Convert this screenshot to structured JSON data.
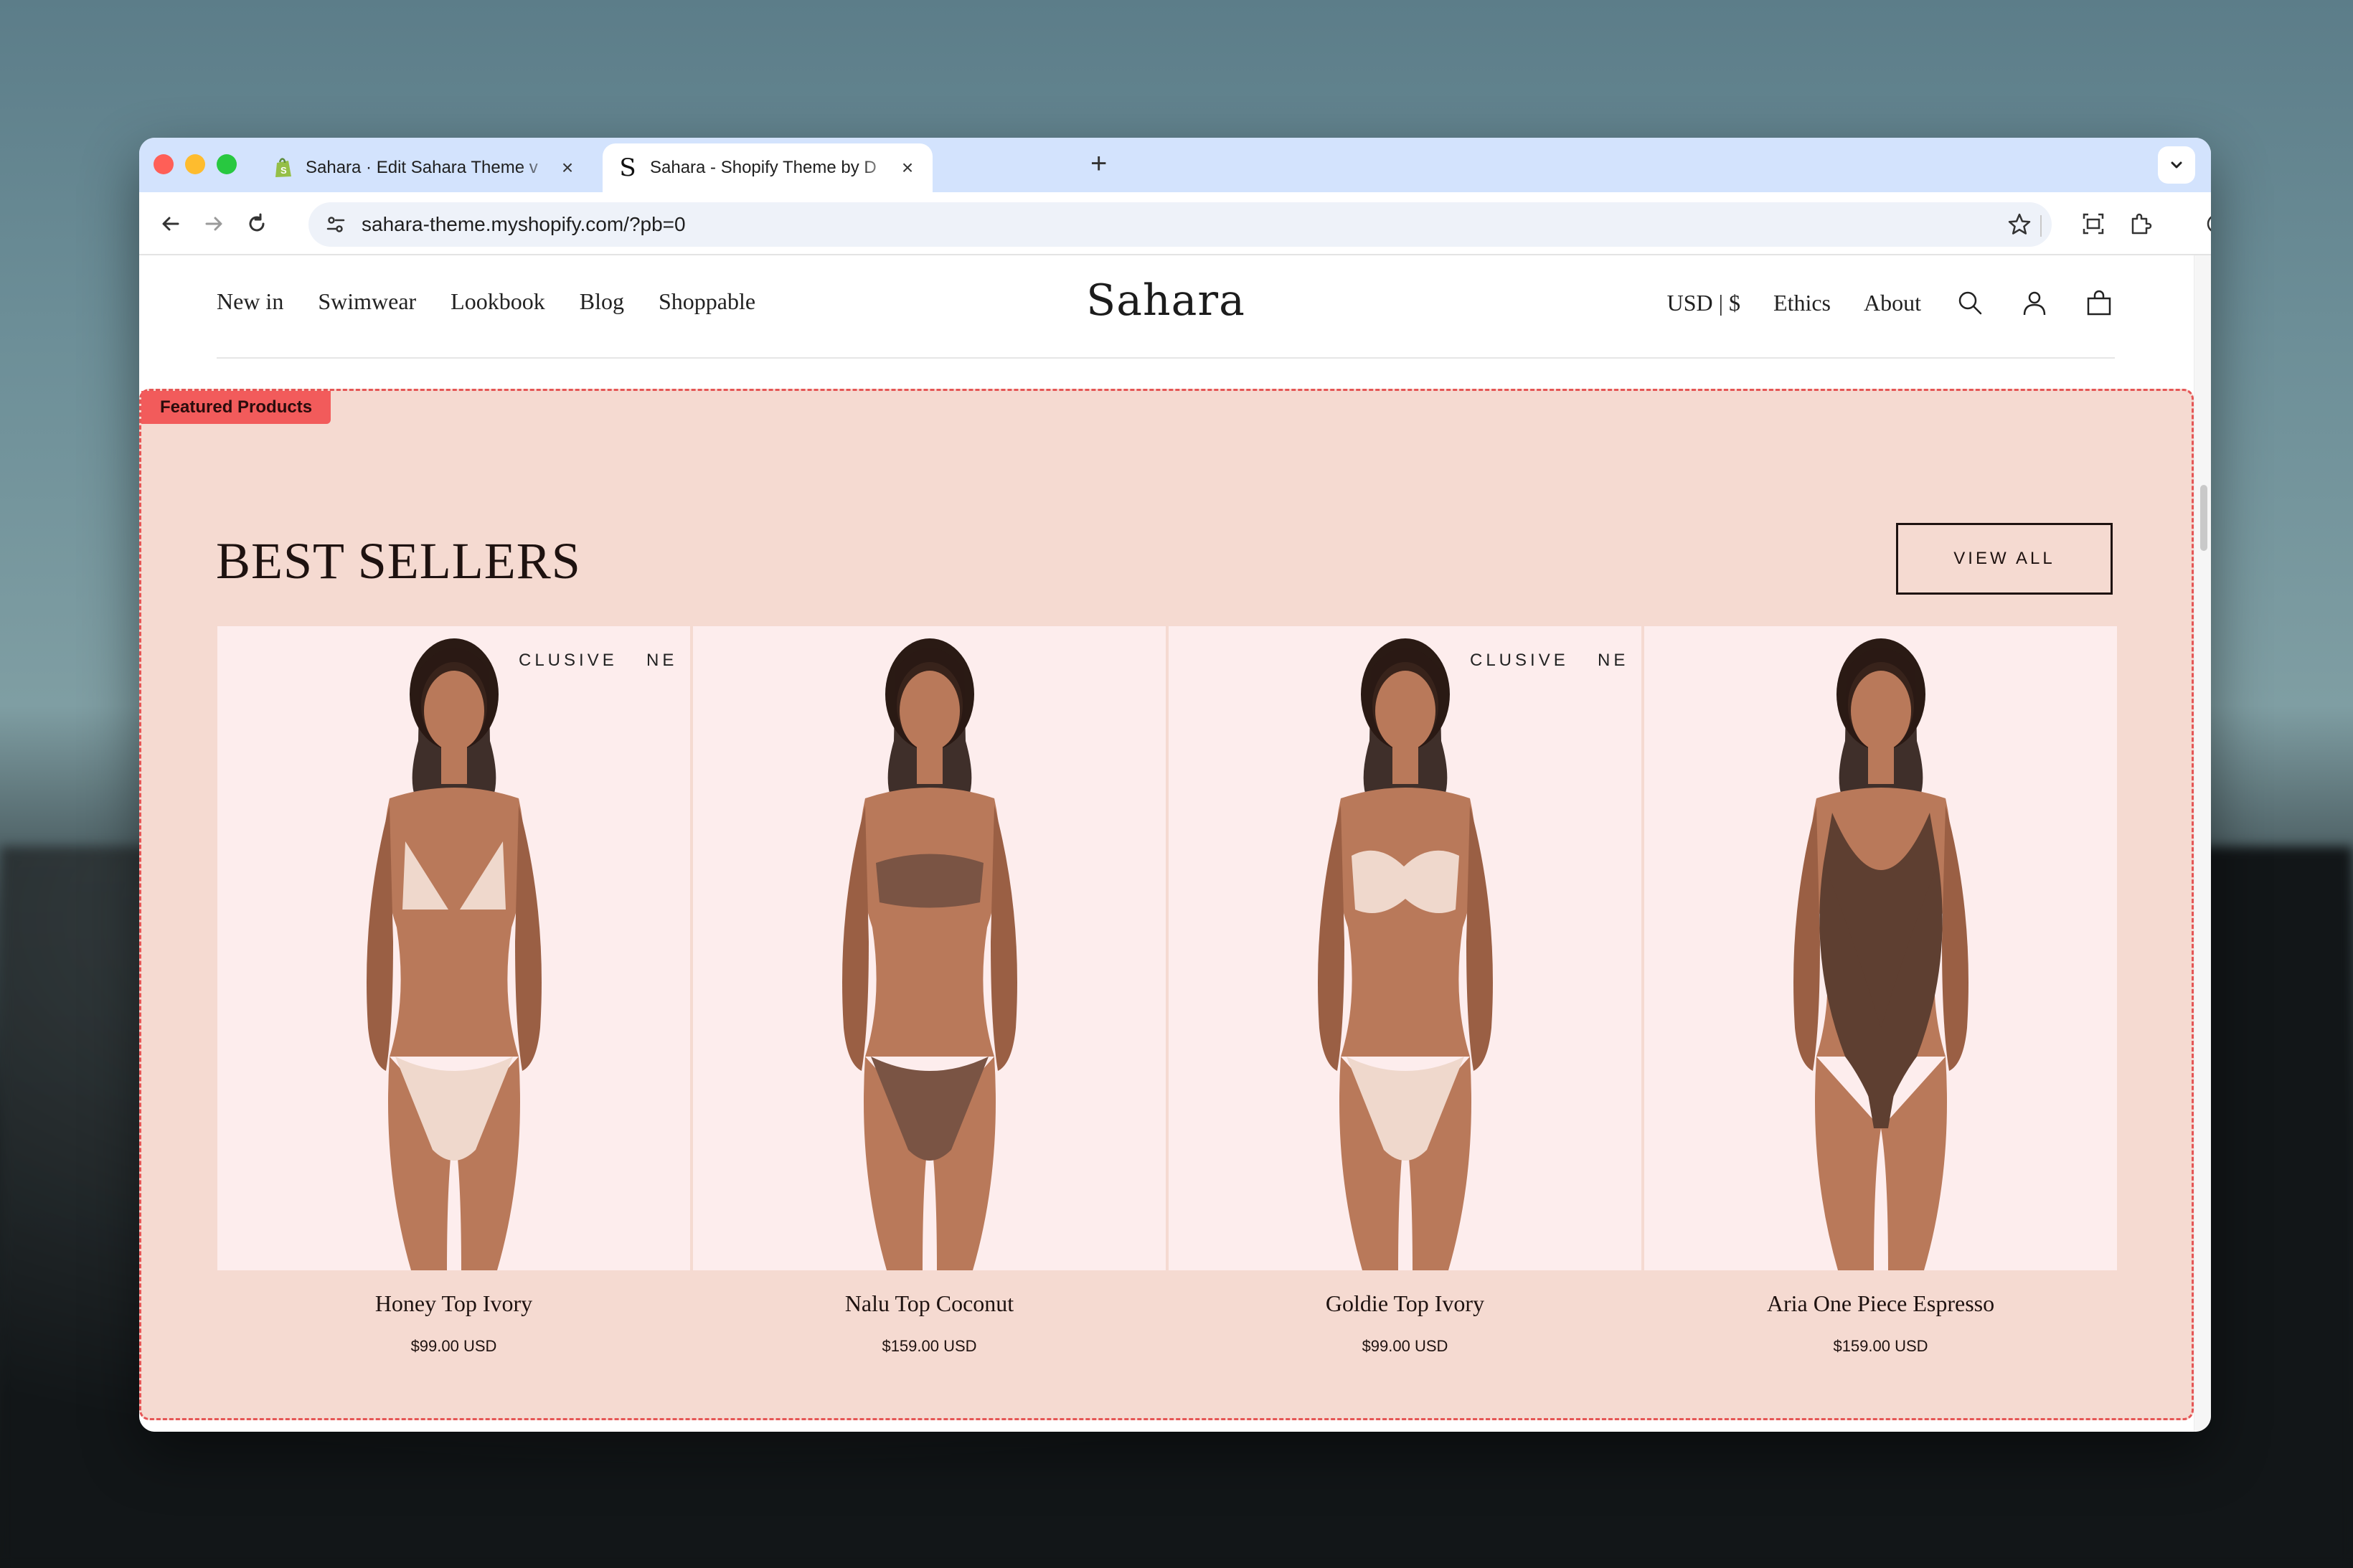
{
  "browser": {
    "tabs": [
      {
        "title": "Sahara · Edit Sahara Theme v",
        "favicon": "shopify-icon",
        "active": false
      },
      {
        "title": "Sahara - Shopify Theme by D",
        "favicon": "sahara-s-icon",
        "active": true
      }
    ],
    "url": "sahara-theme.myshopify.com/?pb=0"
  },
  "site": {
    "logo": "Sahara",
    "nav_left": [
      "New in",
      "Swimwear",
      "Lookbook",
      "Blog",
      "Shoppable"
    ],
    "currency": "USD | $",
    "nav_right": [
      "Ethics",
      "About"
    ]
  },
  "section": {
    "badge": "Featured Products",
    "heading": "BEST SELLERS",
    "view_all": "VIEW ALL",
    "products": [
      {
        "name": "Honey Top Ivory",
        "price": "$99.00 USD",
        "tag1": "CLUSIVE",
        "tag2": "NE",
        "suit_color": "#efd8cc",
        "style": "triangle"
      },
      {
        "name": "Nalu Top Coconut",
        "price": "$159.00 USD",
        "tag1": "",
        "tag2": "",
        "suit_color": "#7a5444",
        "style": "bandeau"
      },
      {
        "name": "Goldie Top Ivory",
        "price": "$99.00 USD",
        "tag1": "CLUSIVE",
        "tag2": "NE",
        "suit_color": "#efd8cc",
        "style": "underwire"
      },
      {
        "name": "Aria One Piece Espresso",
        "price": "$159.00 USD",
        "tag1": "",
        "tag2": "",
        "suit_color": "#5e3f31",
        "style": "onepiece"
      }
    ]
  },
  "colors": {
    "section_bg": "#f5dad1",
    "badge_bg": "#f25b5b",
    "card_bg": "#fdeded"
  }
}
